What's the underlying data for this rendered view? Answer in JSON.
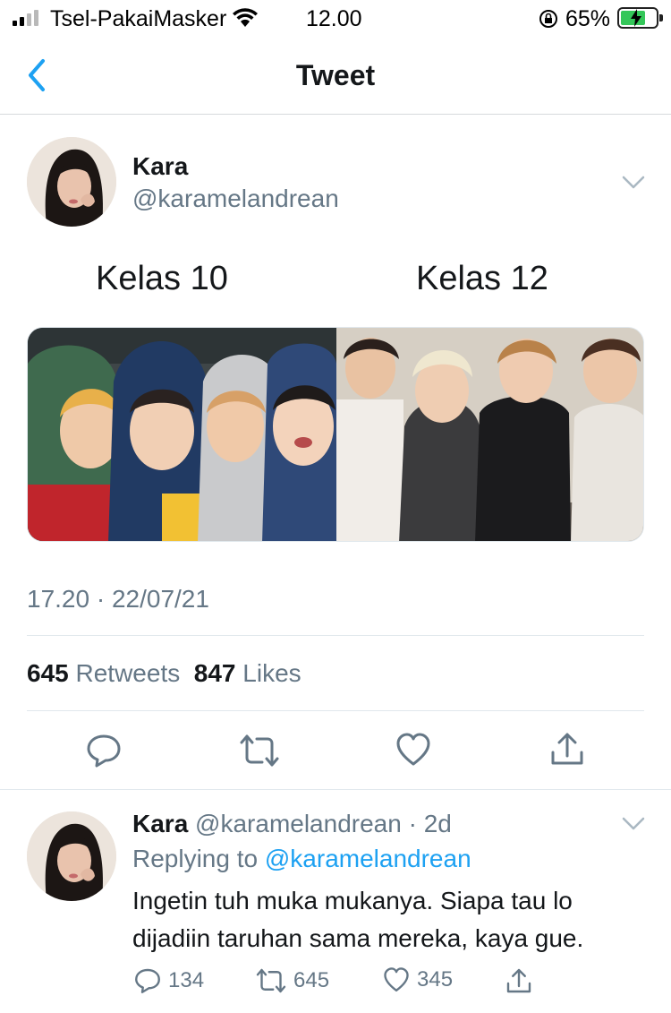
{
  "status_bar": {
    "carrier": "Tsel-PakaiMasker",
    "time": "12.00",
    "battery_percent": "65%",
    "battery_level": 0.65,
    "icons": [
      "signal-icon",
      "wifi-icon",
      "rotation-lock-icon",
      "battery-icon"
    ]
  },
  "nav": {
    "title": "Tweet",
    "back_icon": "chevron-left-icon"
  },
  "tweet": {
    "author_name": "Kara",
    "author_handle": "@karamelandrean",
    "caption_left": "Kelas 10",
    "caption_right": "Kelas 12",
    "timestamp": "17.20 · 22/07/21",
    "retweet_count": "645",
    "retweet_label": "Retweets",
    "like_count": "847",
    "like_label": "Likes",
    "actions": [
      "reply-icon",
      "retweet-icon",
      "like-icon",
      "share-icon"
    ]
  },
  "reply": {
    "author_name": "Kara",
    "author_handle": "@karamelandrean",
    "time_ago": "· 2d",
    "replying_prefix": "Replying to",
    "replying_to": "@karamelandrean",
    "text": "Ingetin tuh muka mukanya. Siapa tau lo dijadiin taruhan sama mereka, kaya gue.",
    "reply_count": "134",
    "retweet_count": "645",
    "like_count": "345"
  },
  "colors": {
    "accent": "#1da1f2",
    "text_primary": "#14171a",
    "text_secondary": "#657786",
    "divider": "#e1e8ed"
  }
}
